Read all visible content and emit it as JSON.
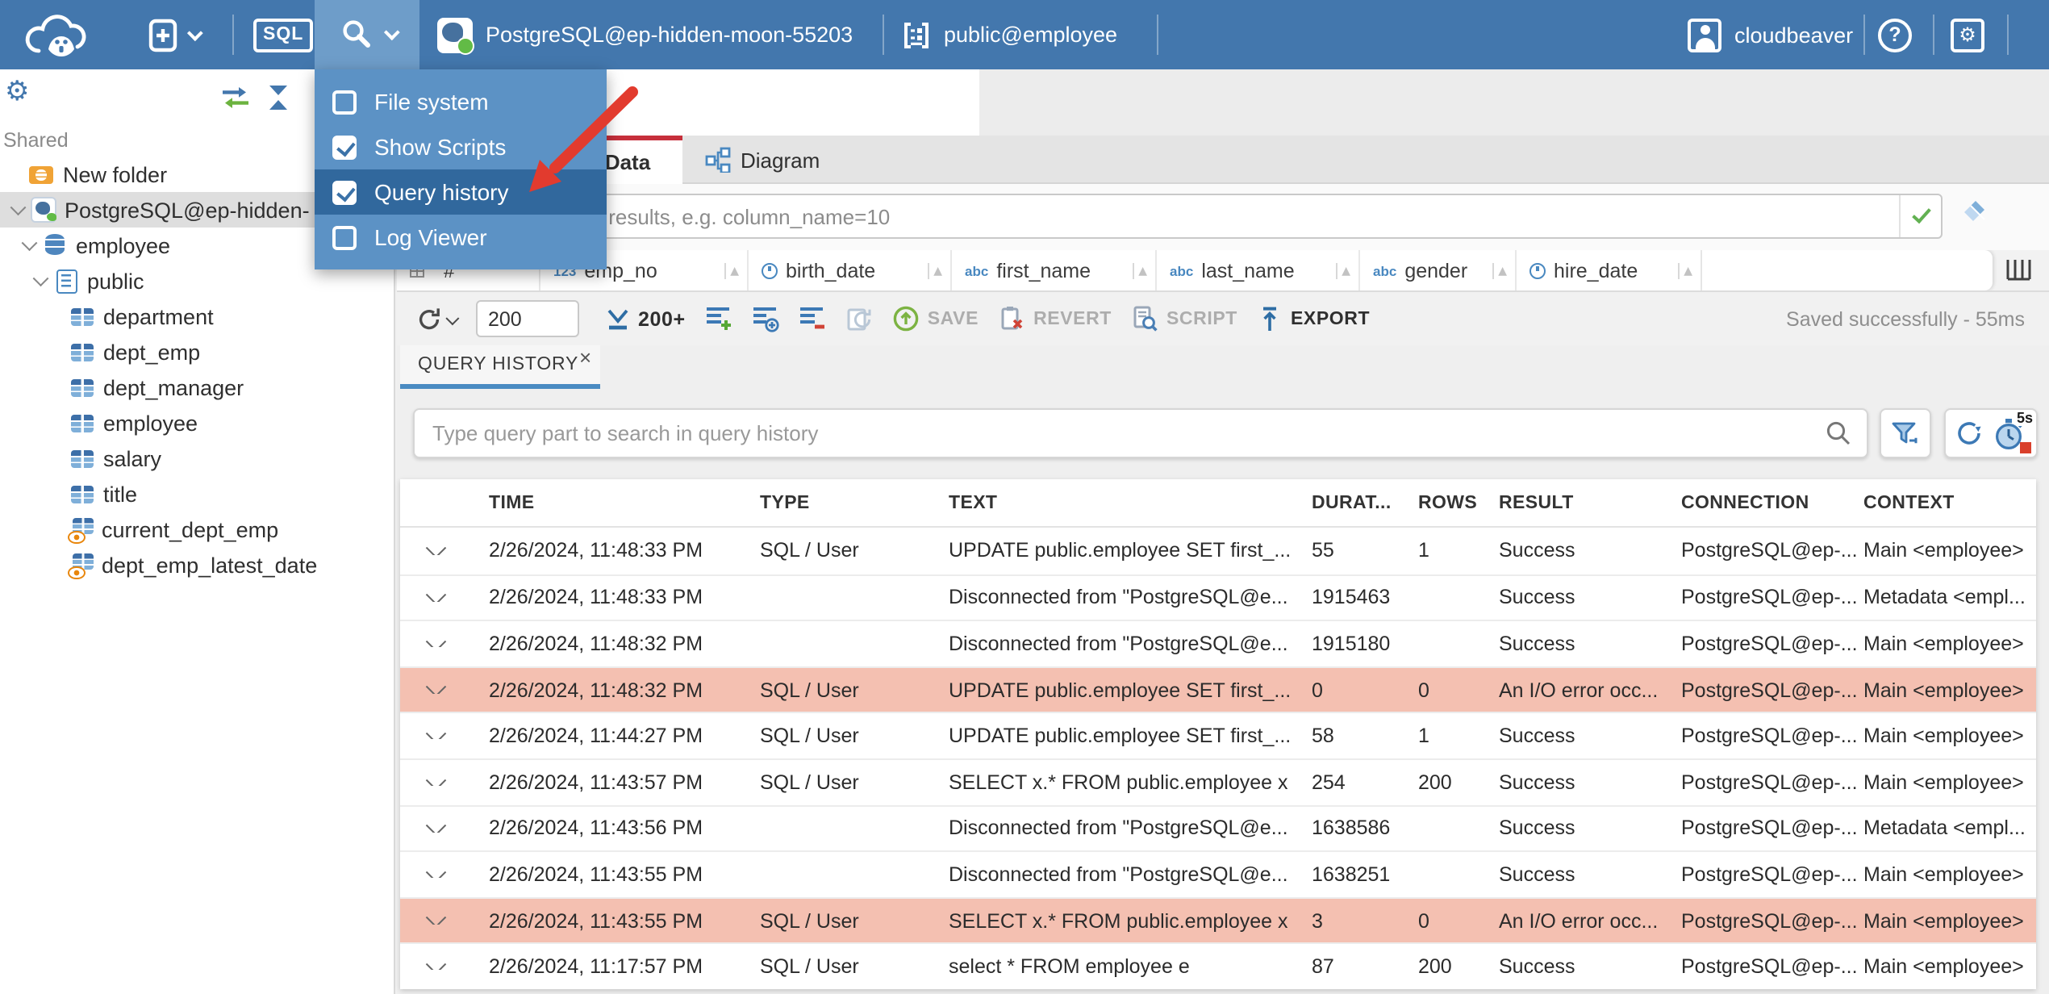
{
  "colors": {
    "topbar_blue": "#4377AD",
    "menu_bg_blue": "#5C92C5",
    "menu_highlight_blue": "#31689D",
    "selection_gray": "#DEDEDE",
    "data_tab_accent_red": "#C62F3B",
    "history_tab_underline_blue": "#4A8BC2",
    "error_row_pink": "#F4C0B1",
    "success_check_green": "#62B152",
    "connection_status_green": "#62BB46"
  },
  "topbar": {
    "sql_label": "SQL",
    "connection_label": "PostgreSQL@ep-hidden-moon-55203",
    "schema_label": "public@employee",
    "username": "cloudbeaver"
  },
  "tools_menu": {
    "items": [
      {
        "label": "File system",
        "checked": false,
        "highlighted": false
      },
      {
        "label": "Show Scripts",
        "checked": true,
        "highlighted": false
      },
      {
        "label": "Query history",
        "checked": true,
        "highlighted": true
      },
      {
        "label": "Log Viewer",
        "checked": false,
        "highlighted": false
      }
    ]
  },
  "sidebar": {
    "section_label": "Shared",
    "tree": [
      {
        "label": "New folder",
        "icon": "folder",
        "indent": 18,
        "chevron": false,
        "selected": false
      },
      {
        "label": "PostgreSQL@ep-hidden-",
        "icon": "postgres",
        "indent": 3,
        "chevron": true,
        "selected": true
      },
      {
        "label": "employee",
        "icon": "database",
        "indent": 10,
        "chevron": true,
        "selected": false
      },
      {
        "label": "public",
        "icon": "schema",
        "indent": 17,
        "chevron": true,
        "selected": false
      },
      {
        "label": "department",
        "icon": "table",
        "indent": 43,
        "chevron": false,
        "selected": false
      },
      {
        "label": "dept_emp",
        "icon": "table",
        "indent": 43,
        "chevron": false,
        "selected": false
      },
      {
        "label": "dept_manager",
        "icon": "table",
        "indent": 43,
        "chevron": false,
        "selected": false
      },
      {
        "label": "employee",
        "icon": "table",
        "indent": 43,
        "chevron": false,
        "selected": false
      },
      {
        "label": "salary",
        "icon": "table",
        "indent": 43,
        "chevron": false,
        "selected": false
      },
      {
        "label": "title",
        "icon": "table",
        "indent": 43,
        "chevron": false,
        "selected": false
      },
      {
        "label": "current_dept_emp",
        "icon": "view",
        "indent": 42,
        "chevron": false,
        "selected": false
      },
      {
        "label": "dept_emp_latest_date",
        "icon": "view",
        "indent": 42,
        "chevron": false,
        "selected": false
      }
    ]
  },
  "object_page": {
    "tab_data": "Data",
    "tab_diagram": "Diagram",
    "filter_placeholder": "expression to filter results, e.g. column_name=10",
    "row_number_header": "#",
    "grid_columns": [
      {
        "kind": "num",
        "badge": "123",
        "label": "emp_no"
      },
      {
        "kind": "date",
        "badge": "",
        "label": "birth_date"
      },
      {
        "kind": "text",
        "badge": "abc",
        "label": "first_name"
      },
      {
        "kind": "text",
        "badge": "abc",
        "label": "last_name"
      },
      {
        "kind": "text",
        "badge": "abc",
        "label": "gender"
      },
      {
        "kind": "date",
        "badge": "",
        "label": "hire_date"
      }
    ]
  },
  "toolbar": {
    "row_limit_value": "200",
    "fetch_more_label": "200+",
    "save_label": "SAVE",
    "revert_label": "REVERT",
    "script_label": "SCRIPT",
    "export_label": "EXPORT",
    "status_message": "Saved successfully - 55ms"
  },
  "query_history": {
    "tab_label": "QUERY HISTORY",
    "search_placeholder": "Type query part to search in query history",
    "refresh_interval_label": "5s",
    "columns": [
      "TIME",
      "TYPE",
      "TEXT",
      "DURAT...",
      "ROWS",
      "RESULT",
      "CONNECTION",
      "CONTEXT"
    ],
    "rows": [
      {
        "time": "2/26/2024, 11:48:33 PM",
        "type": "SQL / User",
        "text": "UPDATE public.employee SET first_...",
        "duration": "55",
        "rows": "1",
        "result": "Success",
        "connection": "PostgreSQL@ep-...",
        "context": "Main <employee>",
        "error": false
      },
      {
        "time": "2/26/2024, 11:48:33 PM",
        "type": "",
        "text": "Disconnected from \"PostgreSQL@e...",
        "duration": "1915463",
        "rows": "",
        "result": "Success",
        "connection": "PostgreSQL@ep-...",
        "context": "Metadata <empl...",
        "error": false
      },
      {
        "time": "2/26/2024, 11:48:32 PM",
        "type": "",
        "text": "Disconnected from \"PostgreSQL@e...",
        "duration": "1915180",
        "rows": "",
        "result": "Success",
        "connection": "PostgreSQL@ep-...",
        "context": "Main <employee>",
        "error": false
      },
      {
        "time": "2/26/2024, 11:48:32 PM",
        "type": "SQL / User",
        "text": "UPDATE public.employee SET first_...",
        "duration": "0",
        "rows": "0",
        "result": "An I/O error occ...",
        "connection": "PostgreSQL@ep-...",
        "context": "Main <employee>",
        "error": true
      },
      {
        "time": "2/26/2024, 11:44:27 PM",
        "type": "SQL / User",
        "text": "UPDATE public.employee SET first_...",
        "duration": "58",
        "rows": "1",
        "result": "Success",
        "connection": "PostgreSQL@ep-...",
        "context": "Main <employee>",
        "error": false
      },
      {
        "time": "2/26/2024, 11:43:57 PM",
        "type": "SQL / User",
        "text": "SELECT x.* FROM public.employee x",
        "duration": "254",
        "rows": "200",
        "result": "Success",
        "connection": "PostgreSQL@ep-...",
        "context": "Main <employee>",
        "error": false
      },
      {
        "time": "2/26/2024, 11:43:56 PM",
        "type": "",
        "text": "Disconnected from \"PostgreSQL@e...",
        "duration": "1638586",
        "rows": "",
        "result": "Success",
        "connection": "PostgreSQL@ep-...",
        "context": "Metadata <empl...",
        "error": false
      },
      {
        "time": "2/26/2024, 11:43:55 PM",
        "type": "",
        "text": "Disconnected from \"PostgreSQL@e...",
        "duration": "1638251",
        "rows": "",
        "result": "Success",
        "connection": "PostgreSQL@ep-...",
        "context": "Main <employee>",
        "error": false
      },
      {
        "time": "2/26/2024, 11:43:55 PM",
        "type": "SQL / User",
        "text": "SELECT x.* FROM public.employee x",
        "duration": "3",
        "rows": "0",
        "result": "An I/O error occ...",
        "connection": "PostgreSQL@ep-...",
        "context": "Main <employee>",
        "error": true
      },
      {
        "time": "2/26/2024, 11:17:57 PM",
        "type": "SQL / User",
        "text": "select * FROM employee e",
        "duration": "87",
        "rows": "200",
        "result": "Success",
        "connection": "PostgreSQL@ep-...",
        "context": "Main <employee>",
        "error": false
      }
    ]
  }
}
